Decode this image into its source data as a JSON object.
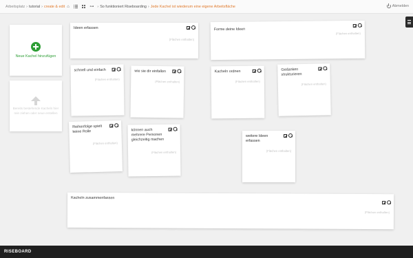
{
  "breadcrumb": {
    "root": "Arbeitsplatz",
    "workspace": "tutorial",
    "mode": "create & edit",
    "board": "So funktioniert Riseboarding",
    "tile": "Jede Kachel ist wiederum eine eigene Arbeitsfläche",
    "separator": "›"
  },
  "header": {
    "logout_label": "Abmelden"
  },
  "add_tile": {
    "label": "Neue Kachel hinzufügen",
    "hint": "Bereits bestehende Kacheln hier rein ziehen oder neue erstellen"
  },
  "tile_empty_label": "(Flächen enthalten)",
  "tiles": [
    {
      "title": "Ideen erfassen"
    },
    {
      "title": "Forme deine Ideen"
    },
    {
      "title": "schnell und einfach"
    },
    {
      "title": "wie sie dir einfallen"
    },
    {
      "title": "Kacheln ordnen"
    },
    {
      "title": "Gedanken strukturieren"
    },
    {
      "title": "Reihenfolge spielt keine Rolle"
    },
    {
      "title": "können auch mehrere Personen gleichzeitig machen"
    },
    {
      "title": "weitere Ideen erfassen"
    },
    {
      "title": "Kacheln zusammenfassen"
    }
  ],
  "footer": {
    "brand": "RISEBOARD"
  },
  "colors": {
    "accent": "#e07b2e",
    "add_green": "#2e9e36",
    "footer_bg": "#1f1f1f"
  }
}
